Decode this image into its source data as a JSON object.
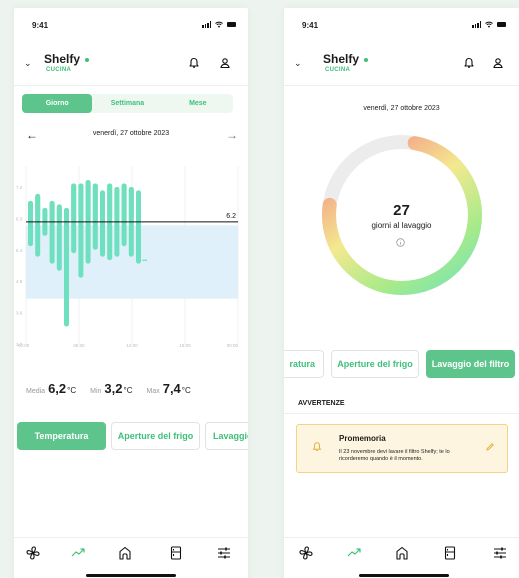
{
  "status": {
    "time": "9:41"
  },
  "app": {
    "name": "Shelfy",
    "room": "CUCINA",
    "accent": "#3fc07a"
  },
  "left": {
    "segments": [
      "Giorno",
      "Settimana",
      "Mese"
    ],
    "selected_segment": "Giorno",
    "date": "venerdì, 27 ottobre 2023",
    "chart_data": {
      "type": "bar",
      "y_ticks": [
        "7.2",
        "6.3",
        "5.4",
        "4.5",
        "3.6",
        "2.7"
      ],
      "x_ticks": [
        "00:00",
        "06:00",
        "12:00",
        "18:00",
        "00:00"
      ],
      "reference_line": {
        "value": 6.2,
        "label": "6.2"
      },
      "band": [
        4.0,
        6.1
      ],
      "ylim": [
        2.7,
        7.8
      ],
      "bars": [
        {
          "low": 5.5,
          "high": 6.8
        },
        {
          "low": 5.2,
          "high": 7.0
        },
        {
          "low": 5.8,
          "high": 6.6
        },
        {
          "low": 5.0,
          "high": 6.8
        },
        {
          "low": 4.8,
          "high": 6.7
        },
        {
          "low": 3.2,
          "high": 6.6
        },
        {
          "low": 5.3,
          "high": 7.3
        },
        {
          "low": 4.6,
          "high": 7.3
        },
        {
          "low": 5.0,
          "high": 7.4
        },
        {
          "low": 5.4,
          "high": 7.3
        },
        {
          "low": 5.2,
          "high": 7.1
        },
        {
          "low": 5.1,
          "high": 7.3
        },
        {
          "low": 5.2,
          "high": 7.2
        },
        {
          "low": 5.5,
          "high": 7.3
        },
        {
          "low": 5.2,
          "high": 7.2
        },
        {
          "low": 5.0,
          "high": 7.1
        }
      ],
      "colors": {
        "high": "#8fe08a",
        "low": "#6ee0c0",
        "band": "#dff0fa",
        "line": "#111111"
      }
    },
    "stats": {
      "media_label": "Media",
      "media_value": "6,2",
      "media_unit": "°C",
      "min_label": "Min",
      "min_value": "3,2",
      "min_unit": "°C",
      "max_label": "Max",
      "max_value": "7,4",
      "max_unit": "°C"
    },
    "pills": [
      "Temperatura",
      "Aperture del frigo",
      "Lavaggio"
    ]
  },
  "right": {
    "date": "venerdì, 27 ottobre 2023",
    "days_value": "27",
    "days_label": "giorni al lavaggio",
    "ring_progress": 0.93,
    "pills": [
      "ratura",
      "Aperture del frigo",
      "Lavaggio del filtro"
    ],
    "warnings_title": "AVVERTENZE",
    "reminder": {
      "title": "Promemoria",
      "text": "Il 23 novembre devi lavare il filtro Shelfy; te lo ricorderemo quando è il momento."
    }
  },
  "tabbar": [
    "fan-icon",
    "trend-icon",
    "home-icon",
    "fridge-icon",
    "sliders-icon"
  ]
}
